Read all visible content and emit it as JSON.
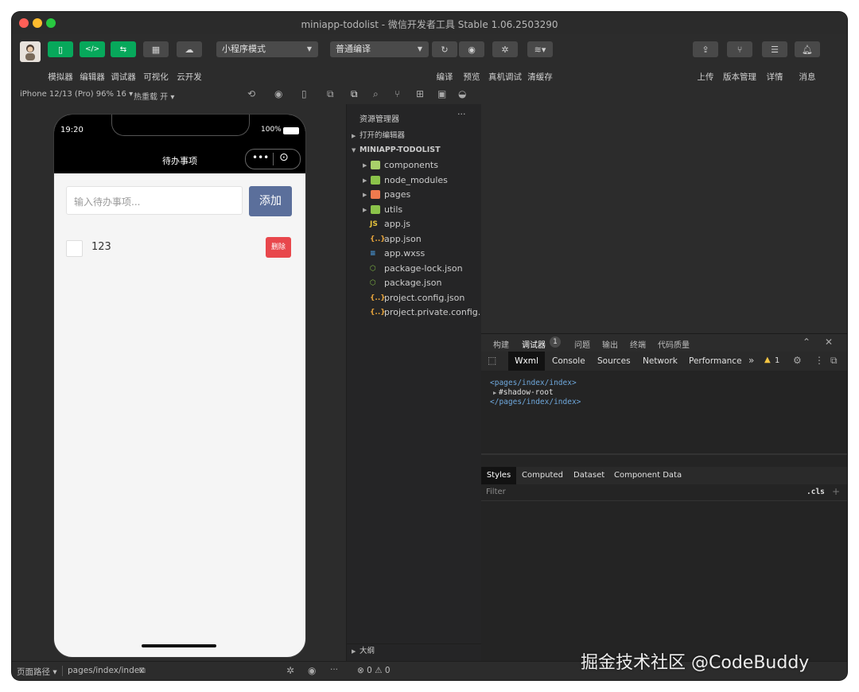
{
  "window": {
    "title": "miniapp-todolist - 微信开发者工具 Stable 1.06.2503290"
  },
  "toolbar": {
    "left_buttons": [
      {
        "label": "模拟器",
        "icon": "phone-icon"
      },
      {
        "label": "编辑器",
        "icon": "code-icon"
      },
      {
        "label": "调试器",
        "icon": "debugger-icon"
      },
      {
        "label": "可视化",
        "icon": "layout-icon"
      },
      {
        "label": "云开发",
        "icon": "cloud-icon"
      }
    ],
    "mode_select": "小程序模式",
    "compile_select": "普通编译",
    "mid_buttons": [
      {
        "label": "编译",
        "icon": "refresh-icon"
      },
      {
        "label": "预览",
        "icon": "eye-icon"
      },
      {
        "label": "真机调试",
        "icon": "bug-icon"
      },
      {
        "label": "清缓存",
        "icon": "layers-icon"
      }
    ],
    "right_buttons": [
      {
        "label": "上传",
        "icon": "upload-icon"
      },
      {
        "label": "版本管理",
        "icon": "branch-icon"
      },
      {
        "label": "详情",
        "icon": "menu-icon"
      },
      {
        "label": "消息",
        "icon": "bell-icon"
      }
    ]
  },
  "simulator": {
    "device_label": "iPhone 12/13 (Pro) 96% 16 ▾",
    "hot_reload_label": "热重载 开 ▾",
    "status_time": "19:20",
    "battery": "100%",
    "nav_title": "待办事项",
    "input_placeholder": "输入待办事项...",
    "add_button": "添加",
    "todos": [
      {
        "text": "123",
        "done": false,
        "delete_label": "删除"
      }
    ]
  },
  "explorer": {
    "title": "资源管理器",
    "open_editors": "打开的编辑器",
    "project": "MINIAPP-TODOLIST",
    "folders": [
      {
        "name": "components",
        "color": "#a8d06a"
      },
      {
        "name": "node_modules",
        "color": "#8bc34a"
      },
      {
        "name": "pages",
        "color": "#ef7a4e"
      },
      {
        "name": "utils",
        "color": "#8bc34a"
      }
    ],
    "files": [
      {
        "name": "app.js",
        "icon": "js-file-icon",
        "glyph": "JS",
        "color": "#e5c33c"
      },
      {
        "name": "app.json",
        "icon": "json-file-icon",
        "glyph": "{..}",
        "color": "#e5a33c"
      },
      {
        "name": "app.wxss",
        "icon": "wxss-file-icon",
        "glyph": "≡",
        "color": "#4a9fe5"
      },
      {
        "name": "package-lock.json",
        "icon": "npm-file-icon",
        "glyph": "⬡",
        "color": "#7cb342"
      },
      {
        "name": "package.json",
        "icon": "npm-file-icon",
        "glyph": "⬡",
        "color": "#7cb342"
      },
      {
        "name": "project.config.json",
        "icon": "json-file-icon",
        "glyph": "{..}",
        "color": "#e5a33c"
      },
      {
        "name": "project.private.config....",
        "icon": "json-file-icon",
        "glyph": "{..}",
        "color": "#e5a33c"
      }
    ],
    "outline": "大纲"
  },
  "devtools": {
    "top_tabs": [
      "构建",
      "调试器",
      "问题",
      "输出",
      "终端",
      "代码质量"
    ],
    "debugger_badge": "1",
    "panel_tabs": [
      "Wxml",
      "Console",
      "Sources",
      "Network",
      "Performance"
    ],
    "more": "»",
    "warning_count": "1",
    "xml_lines": [
      "<pages/index/index>",
      "#shadow-root",
      "</pages/index/index>"
    ],
    "style_tabs": [
      "Styles",
      "Computed",
      "Dataset",
      "Component Data"
    ],
    "filter_placeholder": "Filter",
    "cls": ".cls"
  },
  "statusbar": {
    "path_label": "页面路径 ▾",
    "path_value": "pages/index/index",
    "problems": "⊗ 0 ⚠ 0"
  },
  "watermark": "掘金技术社区 @CodeBuddy",
  "colors": {
    "green": "#07a85b",
    "add_button": "#5b6f9b",
    "delete_button": "#e8474c"
  }
}
